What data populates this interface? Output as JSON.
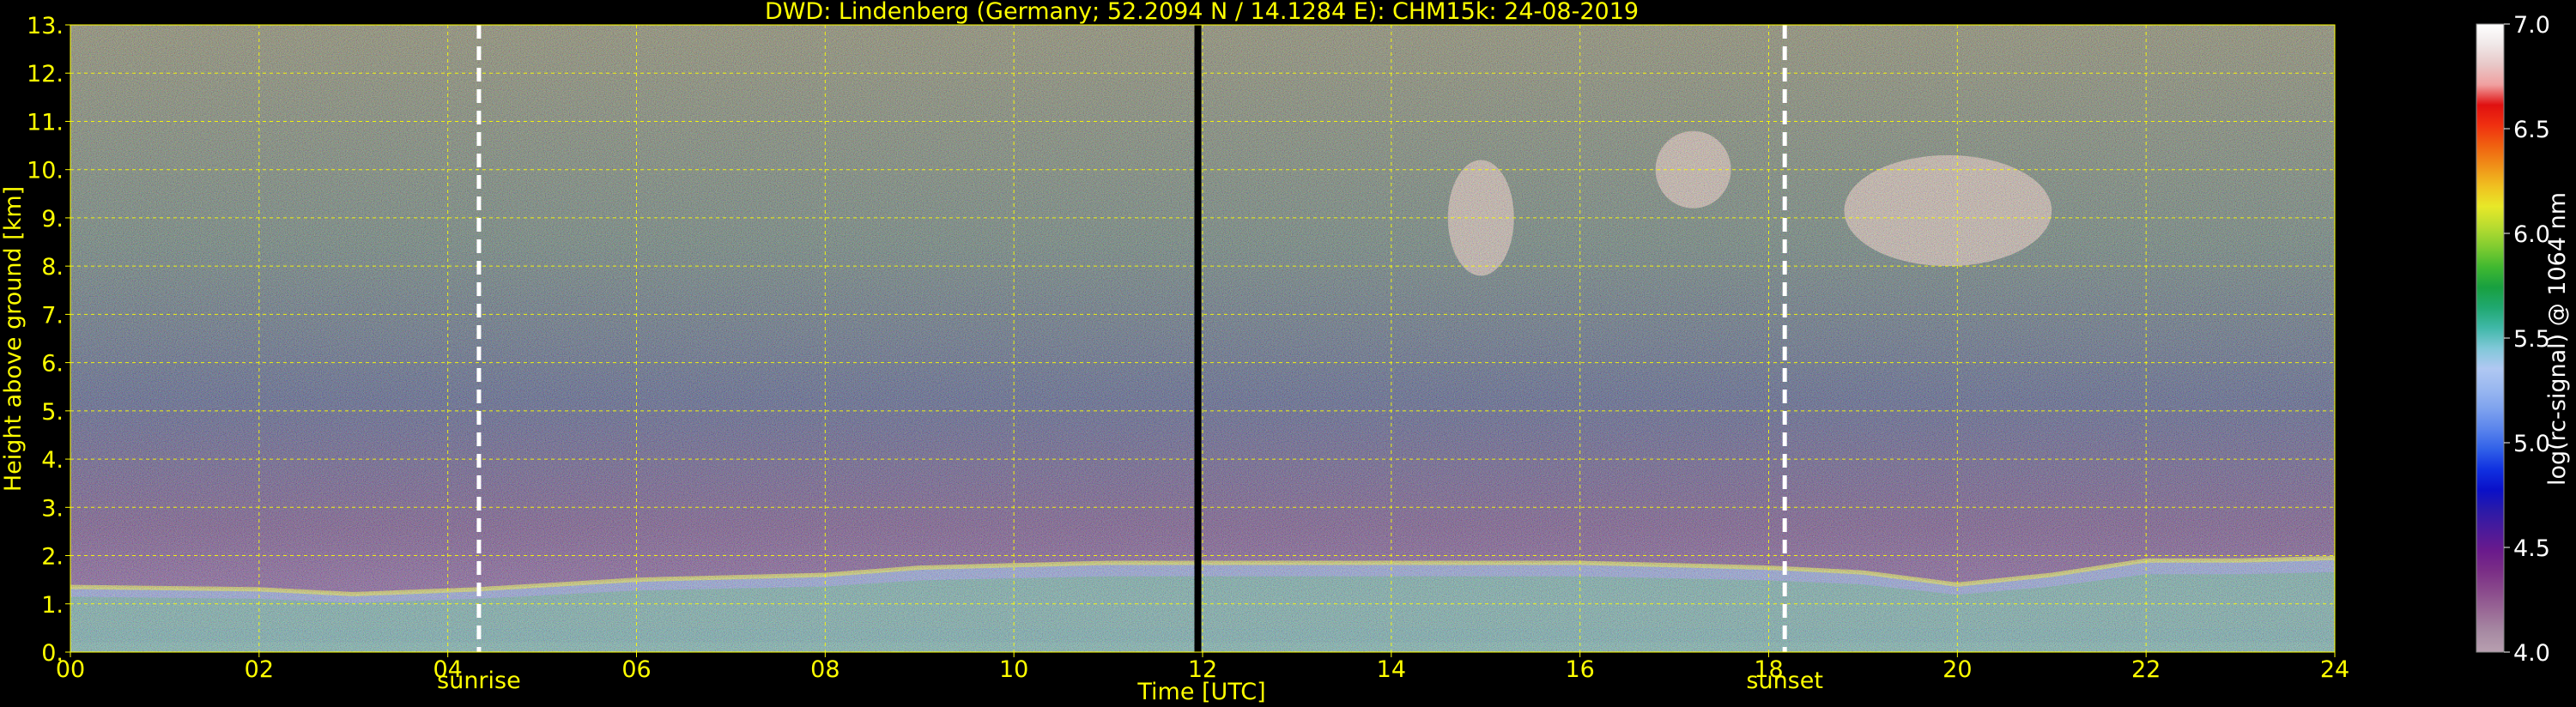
{
  "chart_data": {
    "type": "heatmap",
    "title": "DWD: Lindenberg (Germany; 52.2094 N / 14.1284 E):    CHM15k: 24-08-2019",
    "xlabel": "Time [UTC]",
    "ylabel": "Height above ground [km]",
    "xlim": [
      0,
      24
    ],
    "ylim": [
      0,
      13
    ],
    "x_ticks": [
      0,
      2,
      4,
      6,
      8,
      10,
      12,
      14,
      16,
      18,
      20,
      22,
      24
    ],
    "x_tick_labels": [
      "00",
      "02",
      "04",
      "06",
      "08",
      "10",
      "12",
      "14",
      "16",
      "18",
      "20",
      "22",
      "24"
    ],
    "y_ticks": [
      0,
      1,
      2,
      3,
      4,
      5,
      6,
      7,
      8,
      9,
      10,
      11,
      12,
      13
    ],
    "y_tick_labels": [
      "0.",
      "1.",
      "2.",
      "3.",
      "4.",
      "5.",
      "6.",
      "7.",
      "8.",
      "9.",
      "10.",
      "11.",
      "12.",
      "13."
    ],
    "grid": true,
    "events": [
      {
        "label": "sunrise",
        "time": 4.33
      },
      {
        "label": "sunset",
        "time": 18.17
      }
    ],
    "data_gap_time": 11.95,
    "layers": [
      {
        "kind": "surface_layer",
        "t_start": 0,
        "t_end": 24,
        "bottom_km": 0.2,
        "top_km": 0.5
      },
      {
        "kind": "boundary_layer_top",
        "times": [
          0,
          2,
          3,
          4.3,
          6,
          8,
          9,
          10,
          11,
          12,
          13,
          14,
          15,
          16,
          17,
          18,
          19,
          20,
          21,
          22,
          23,
          24
        ],
        "top_km": [
          1.35,
          1.3,
          1.2,
          1.3,
          1.5,
          1.6,
          1.75,
          1.8,
          1.85,
          1.85,
          1.85,
          1.85,
          1.85,
          1.85,
          1.8,
          1.75,
          1.65,
          1.4,
          1.6,
          1.9,
          1.9,
          1.95
        ]
      },
      {
        "kind": "cirrus",
        "t_start": 14.6,
        "t_end": 15.3,
        "bottom_km": 7.8,
        "top_km": 10.2
      },
      {
        "kind": "cirrus",
        "t_start": 16.8,
        "t_end": 17.6,
        "bottom_km": 9.2,
        "top_km": 10.8
      },
      {
        "kind": "cirrus",
        "t_start": 18.8,
        "t_end": 21.0,
        "bottom_km": 8.0,
        "top_km": 10.3
      }
    ],
    "colorbar": {
      "label": "log(rc-signal) @ 1064 nm",
      "min": 4.0,
      "max": 7.0,
      "tick_values": [
        4.0,
        4.5,
        5.0,
        5.5,
        6.0,
        6.5,
        7.0
      ],
      "tick_labels": [
        "4.0",
        "4.5",
        "5.0",
        "5.5",
        "6.0",
        "6.5",
        "7.0"
      ],
      "colors": [
        "#b8a0b0",
        "#a78aa3",
        "#9a6a96",
        "#8a4a8c",
        "#7a2e86",
        "#6a1a8c",
        "#4b1a9a",
        "#2a1aa8",
        "#0a10c8",
        "#1030e0",
        "#3060e8",
        "#5a84ec",
        "#7ea2ee",
        "#9ab8f0",
        "#b0c8f2",
        "#80c8d8",
        "#40b8a8",
        "#20a870",
        "#18a040",
        "#40b830",
        "#80cc30",
        "#b8dc30",
        "#e8e828",
        "#f0c020",
        "#f09018",
        "#f06010",
        "#f03010",
        "#e01010",
        "#f0a0a0",
        "#e8c8c8",
        "#f0e8e8",
        "#ffffff"
      ]
    },
    "text_color": "#ffff00",
    "grid_color": "#ffff00",
    "background": "#000000"
  }
}
